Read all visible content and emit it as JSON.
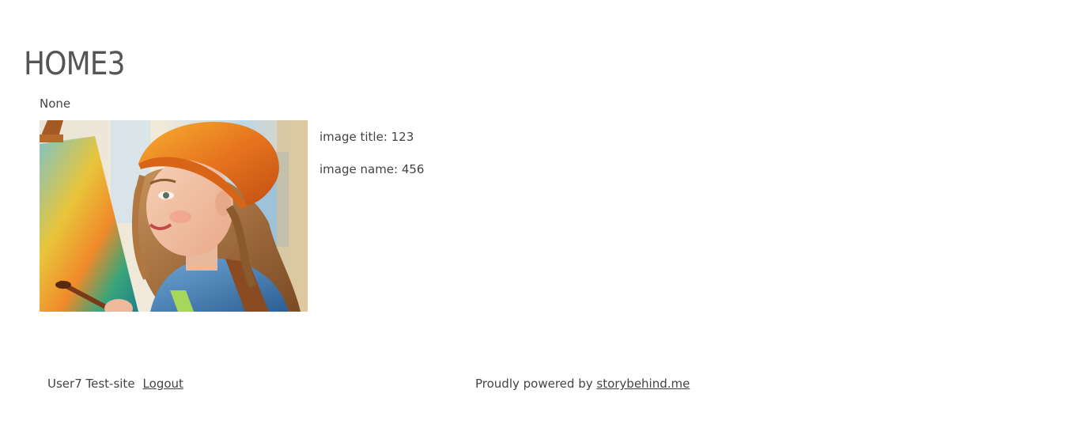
{
  "page": {
    "title": "HOME3",
    "description": "None"
  },
  "image": {
    "title_label": "image title: 123",
    "name_label": "image name: 456",
    "alt": "Painting of a young woman in an orange beanie painting at an easel"
  },
  "footer": {
    "user_label": "User7 Test-site",
    "logout_label": "Logout",
    "powered_prefix": "Proudly powered by",
    "powered_link": "storybehind.me"
  },
  "colors": {
    "text": "#444444",
    "title": "#555555",
    "background": "#ffffff"
  }
}
